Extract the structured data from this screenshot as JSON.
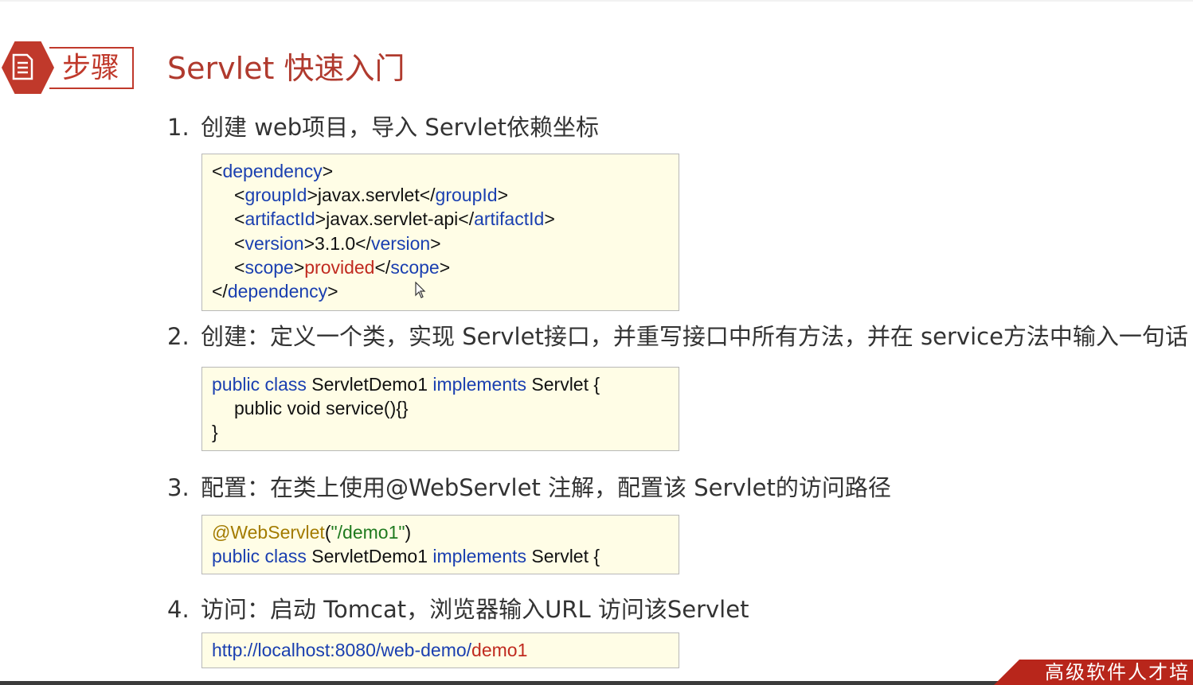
{
  "header": {
    "badge_label": "步骤",
    "badge_icon": "document-icon",
    "title": "Servlet 快速入门"
  },
  "steps": [
    {
      "num": "1.",
      "text": "创建 web项目，导入 Servlet依赖坐标"
    },
    {
      "num": "2.",
      "text": "创建：定义一个类，实现 Servlet接口，并重写接口中所有方法，并在 service方法中输入一句话"
    },
    {
      "num": "3.",
      "text": "配置：在类上使用@WebServlet 注解，配置该 Servlet的访问路径"
    },
    {
      "num": "4.",
      "text": "访问：启动 Tomcat，浏览器输入URL 访问该Servlet"
    }
  ],
  "code1": {
    "line1_open": "<",
    "line1_tag": "dependency",
    "line1_close": ">",
    "line2_open": "<",
    "line2_tag": "groupId",
    "line2_mid": ">javax.servlet</",
    "line2_tag2": "groupId",
    "line2_close": ">",
    "line3_open": "<",
    "line3_tag": "artifactId",
    "line3_mid": ">javax.servlet-api</",
    "line3_tag2": "artifactId",
    "line3_close": ">",
    "line4_open": "<",
    "line4_tag": "version",
    "line4_mid": ">3.1.0</",
    "line4_tag2": "version",
    "line4_close": ">",
    "line5_open": "<",
    "line5_tag": "scope",
    "line5_mid1": ">",
    "line5_value": "provided",
    "line5_mid2": "</",
    "line5_tag2": "scope",
    "line5_close": ">",
    "line6_open": "</",
    "line6_tag": "dependency",
    "line6_close": ">"
  },
  "code2": {
    "kw1": "public class",
    "name": " ServletDemo1 ",
    "kw2": "implements",
    "rest": " Servlet {",
    "line2": "public void service(){}",
    "line3": "}"
  },
  "code3": {
    "anno": "@WebServlet",
    "paren_open": "(",
    "str": "\"/demo1\"",
    "paren_close": ")",
    "kw1": "public class",
    "name": " ServletDemo1 ",
    "kw2": "implements",
    "rest": " Servlet {"
  },
  "code4": {
    "url_base": "http://localhost:8080/web-demo/",
    "url_path": "demo1"
  },
  "footer": {
    "tag_text": "高级软件人才培"
  },
  "colors": {
    "accent": "#c0392b",
    "keyword": "#1a3fb0",
    "highlight": "#c02a1f",
    "string": "#1f7a1f",
    "annotation": "#a37b00",
    "code_bg": "#fffde6"
  }
}
